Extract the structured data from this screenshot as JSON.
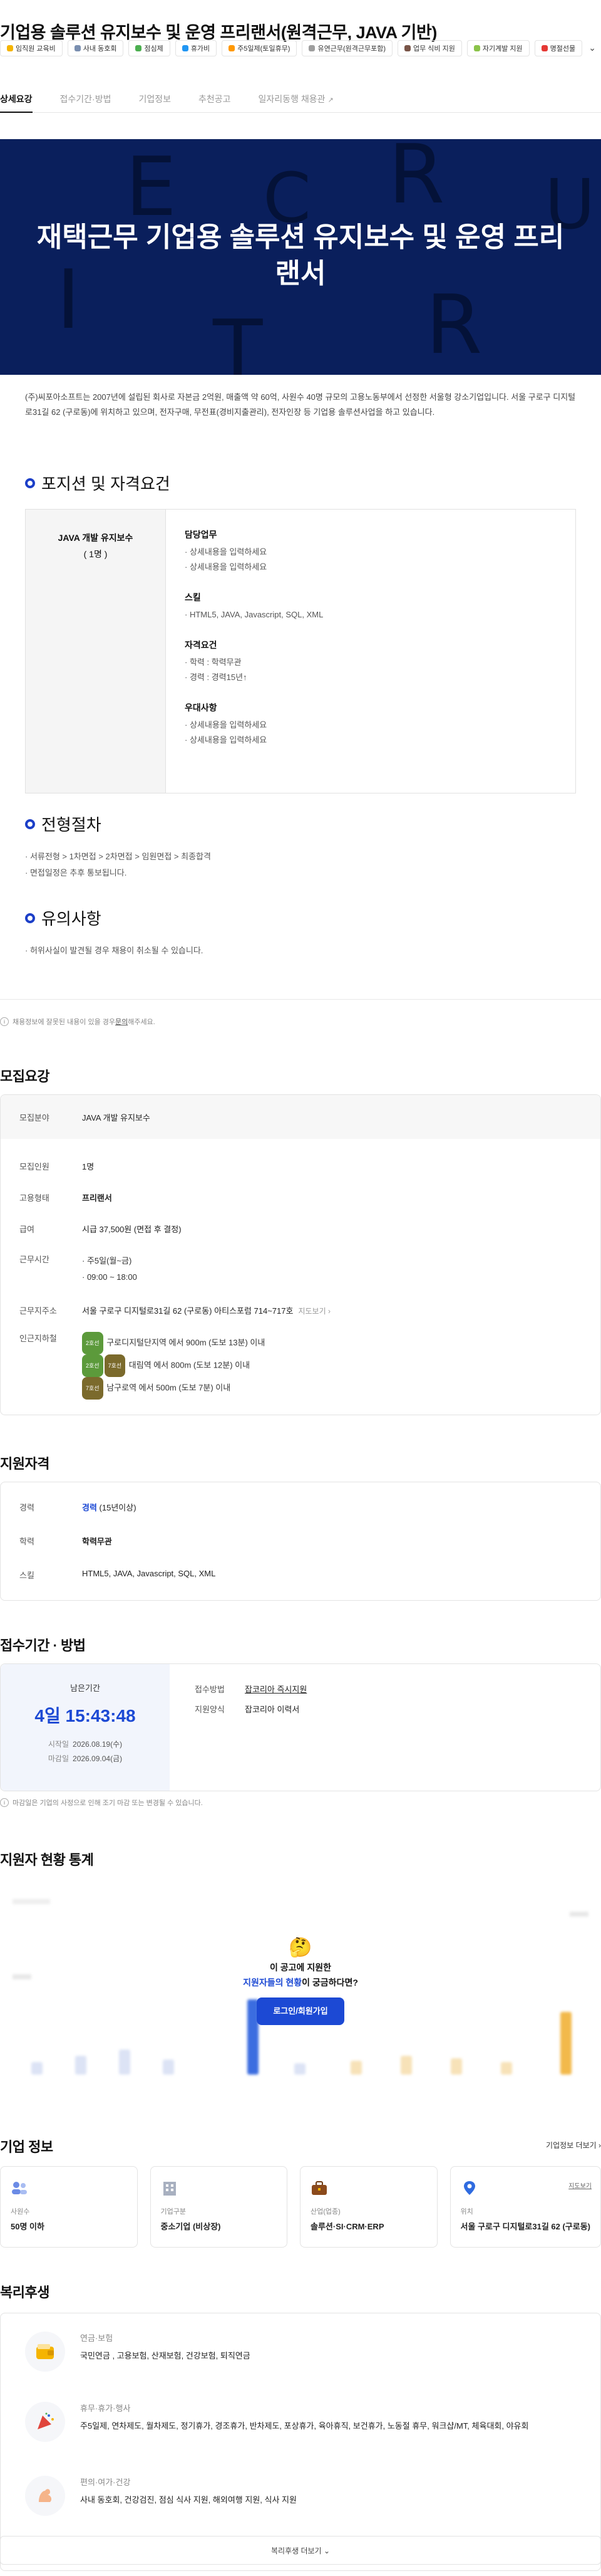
{
  "title": "기업용 솔루션 유지보수 및 운영 프리랜서(원격근무, JAVA 기반)",
  "chips": [
    "임직원 교육비",
    "사내 동호회",
    "점심제",
    "휴가비",
    "주5일제(토일휴무)",
    "유연근무(원격근무포함)",
    "업무 식비 지원",
    "자기계발 지원",
    "명절선물"
  ],
  "chips_more": "⌄",
  "tabs": [
    {
      "label": "상세요강"
    },
    {
      "label": "접수기간·방법"
    },
    {
      "label": "기업정보"
    },
    {
      "label": "추천공고"
    },
    {
      "label": "일자리동행 채용관"
    }
  ],
  "hero": {
    "title": "재택근무 기업용 솔루션 유지보수 및 운영 프리랜서",
    "letters": [
      "E",
      "R",
      "C",
      "U",
      "I",
      "T",
      "R"
    ]
  },
  "intro": "(주)씨포아소프트는 2007년에 설립된 회사로 자본금 2억원, 매출액 약 60억, 사원수 40명 규모의 고용노동부에서 선정한 서울형 강소기업입니다. 서울 구로구 디지털로31길 62 (구로동)에 위치하고 있으며, 전자구매, 무전표(경비지출관리), 전자인장 등 기업용 솔루션사업을 하고 있습니다.",
  "sections": {
    "position": "포지션 및 자격요건",
    "process": "전형절차",
    "caution": "유의사항"
  },
  "position": {
    "name": "JAVA 개발 유지보수",
    "count": "( 1명 )",
    "groups": [
      {
        "title": "담당업무",
        "items": [
          "상세내용을 입력하세요",
          "상세내용을 입력하세요"
        ]
      },
      {
        "title": "스킬",
        "items": [
          "HTML5, JAVA, Javascript, SQL, XML"
        ]
      },
      {
        "title": "자격요건",
        "items": [
          "학력 : 학력무관",
          "경력 : 경력15년↑"
        ]
      },
      {
        "title": "우대사항",
        "items": [
          "상세내용을 입력하세요",
          "상세내용을 입력하세요"
        ]
      }
    ]
  },
  "process_items": [
    "서류전형 > 1차면접 > 2차면접 > 임원면접 > 최종합격",
    "면접일정은 추후 통보됩니다."
  ],
  "caution_items": [
    "허위사실이 발견될 경우 채용이 취소될 수 있습니다."
  ],
  "report_note": {
    "text": "채용정보에 잘못된 내용이 있을 경우 ",
    "link": "문의",
    "tail": "해주세요."
  },
  "recruit": {
    "heading": "모집요강",
    "field_label": "모집분야",
    "field_value": "JAVA 개발 유지보수",
    "count_label": "모집인원",
    "count_value": "1명",
    "type_label": "고용형태",
    "type_value": "프리랜서",
    "pay_label": "급여",
    "pay_value": "시급 37,500원 (면접 후 결정)",
    "time_label": "근무시간",
    "time_values": [
      "주5일(월~금)",
      "09:00 ~ 18:00"
    ],
    "addr_label": "근무지주소",
    "addr_value": "서울 구로구 디지털로31길 62 (구로동) 아티스포럼 714~717호",
    "addr_map": "지도보기",
    "station_label": "인근지하철",
    "stations": [
      {
        "tags": [
          "2호선"
        ],
        "text": "구로디지털단지역 에서 900m (도보 13분) 이내"
      },
      {
        "tags": [
          "2호선",
          "7호선"
        ],
        "text": "대림역 에서 800m (도보 12분) 이내"
      },
      {
        "tags": [
          "7호선"
        ],
        "text": "남구로역 에서 500m (도보 7분) 이내"
      }
    ]
  },
  "qual": {
    "heading": "지원자격",
    "career_label": "경력",
    "career_value": "경력",
    "career_note": " (15년이상)",
    "edu_label": "학력",
    "edu_value": "학력무관",
    "skill_label": "스킬",
    "skill_value": "HTML5, JAVA, Javascript, SQL, XML"
  },
  "apply": {
    "heading": "접수기간 · 방법",
    "remaining_label": "남은기간",
    "countdown": "4일 15:43:48",
    "start_label": "시작일",
    "start_value": "2026.08.19(수)",
    "end_label": "마감일",
    "end_value": "2026.09.04(금)",
    "method_label": "접수방법",
    "method_value": "잡코리아 즉시지원",
    "form_label": "지원양식",
    "form_value": "잡코리아 이력서",
    "note": "마감일은 기업의 사정으로 인해 조기 마감 또는 변경될 수 있습니다."
  },
  "stats": {
    "heading": "지원자 현황 통계",
    "overlay_line1": "이 공고에 지원한",
    "overlay_line2_highlight": "지원자들의 현황",
    "overlay_line2_tail": "이 궁금하다면?",
    "login_label": "로그인/회원가입"
  },
  "company": {
    "heading": "기업 정보",
    "more": "기업정보 더보기",
    "cards": [
      {
        "label": "사원수",
        "value": "50명 이하",
        "icon": "people-icon"
      },
      {
        "label": "기업구분",
        "value": "중소기업 (비상장)",
        "icon": "building-icon"
      },
      {
        "label": "산업(업종)",
        "value": "솔루션·SI·CRM·ERP",
        "icon": "briefcase-icon"
      },
      {
        "label": "위치",
        "value": "서울 구로구 디지털로31길 62 (구로동)",
        "icon": "location-icon",
        "link": "지도보기"
      }
    ]
  },
  "welfare": {
    "heading": "복리후생",
    "items": [
      {
        "title": "연금·보험",
        "desc": "국민연금 , 고용보험, 산재보험, 건강보험, 퇴직연금",
        "icon": "wallet-icon"
      },
      {
        "title": "휴무·휴가·행사",
        "desc": "주5일제, 연차제도, 월차제도, 정기휴가, 경조휴가, 반차제도, 포상휴가, 육아휴직, 보건휴가, 노동절 휴무, 워크샵/MT, 체육대회, 야유회",
        "icon": "party-icon"
      },
      {
        "title": "편의·여가·건강",
        "desc": "사내 동호회, 건강검진, 점심 식사 지원, 해외여행 지원, 식사 지원",
        "icon": "muscle-icon"
      }
    ],
    "more": "복리후생 더보기"
  },
  "colors": {
    "navy": "#0a1f5c",
    "accent": "#1c49d4"
  }
}
